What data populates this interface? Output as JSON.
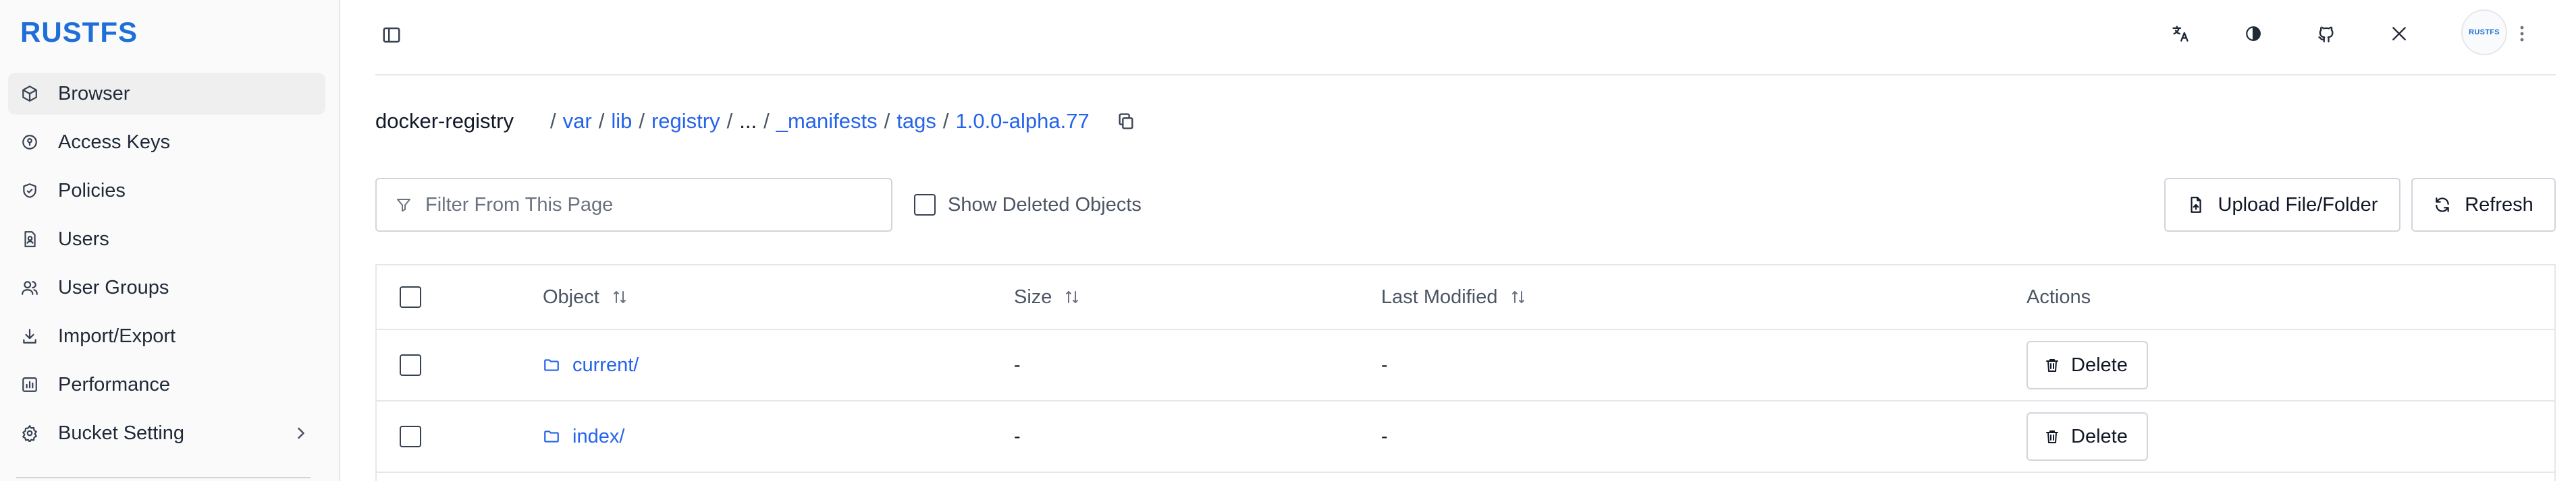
{
  "app": {
    "logo_text": "RUSTFS",
    "brand_color": "#1e6fd8",
    "link_color": "#2563eb"
  },
  "sidebar": {
    "items": [
      {
        "label": "Browser",
        "icon": "box-icon",
        "active": true
      },
      {
        "label": "Access Keys",
        "icon": "key-circle-icon",
        "active": false
      },
      {
        "label": "Policies",
        "icon": "shield-check-icon",
        "active": false
      },
      {
        "label": "Users",
        "icon": "user-file-icon",
        "active": false
      },
      {
        "label": "User Groups",
        "icon": "users-icon",
        "active": false
      },
      {
        "label": "Import/Export",
        "icon": "download-icon",
        "active": false
      },
      {
        "label": "Performance",
        "icon": "bar-chart-icon",
        "active": false
      },
      {
        "label": "Bucket Setting",
        "icon": "gear-icon",
        "active": false,
        "has_submenu": true
      }
    ]
  },
  "header": {
    "icons": [
      "translate-icon",
      "theme-icon",
      "github-icon",
      "x-icon"
    ],
    "avatar_text": "RUSTFS"
  },
  "breadcrumb": {
    "bucket": "docker-registry",
    "separator": "/",
    "segments": [
      "var",
      "lib",
      "registry"
    ],
    "ellipsis": "...",
    "tail_segments": [
      "_manifests",
      "tags",
      "1.0.0-alpha.77"
    ]
  },
  "toolbar": {
    "filter_placeholder": "Filter From This Page",
    "show_deleted_label": "Show Deleted Objects",
    "show_deleted_checked": false,
    "upload_label": "Upload File/Folder",
    "refresh_label": "Refresh"
  },
  "table": {
    "columns": [
      "Object",
      "Size",
      "Last Modified",
      "Actions"
    ],
    "rows": [
      {
        "name": "current/",
        "size": "-",
        "modified": "-",
        "action": "Delete"
      },
      {
        "name": "index/",
        "size": "-",
        "modified": "-",
        "action": "Delete"
      }
    ]
  }
}
